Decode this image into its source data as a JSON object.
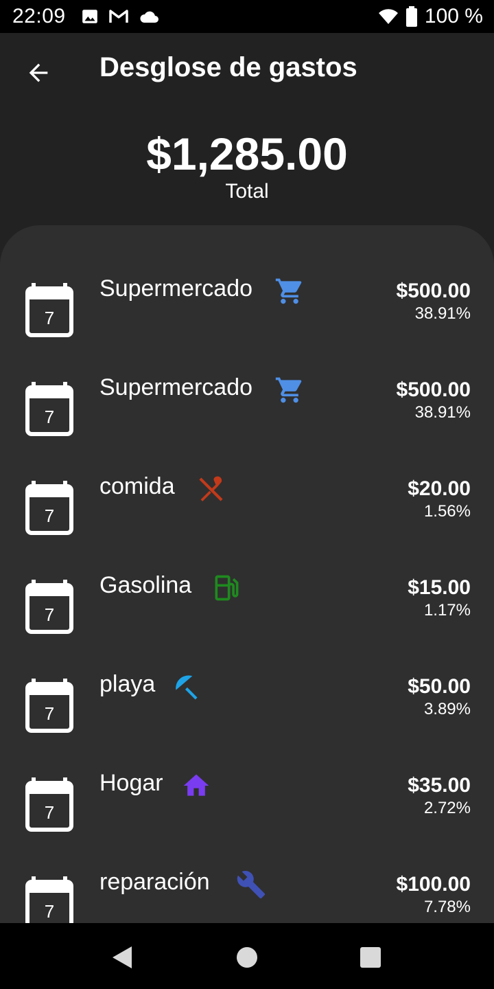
{
  "status_bar": {
    "time": "22:09",
    "battery_text": "100 %",
    "icons": [
      "image-icon",
      "gmail-icon",
      "cloud-icon",
      "wifi-icon",
      "battery-icon"
    ]
  },
  "app_bar": {
    "title": "Desglose de gastos",
    "back_icon": "arrow-back-icon"
  },
  "summary": {
    "total": "$1,285.00",
    "label": "Total"
  },
  "expenses": [
    {
      "name": "Supermercado",
      "date_day": "7",
      "amount": "$500.00",
      "percent": "38.91%",
      "icon": "shopping-cart-icon",
      "icon_color": "#4f8fe6"
    },
    {
      "name": "Supermercado",
      "date_day": "7",
      "amount": "$500.00",
      "percent": "38.91%",
      "icon": "shopping-cart-icon",
      "icon_color": "#4f8fe6"
    },
    {
      "name": "comida",
      "date_day": "7",
      "amount": "$20.00",
      "percent": "1.56%",
      "icon": "restaurant-icon",
      "icon_color": "#c23a1a"
    },
    {
      "name": "Gasolina",
      "date_day": "7",
      "amount": "$15.00",
      "percent": "1.17%",
      "icon": "gas-station-icon",
      "icon_color": "#1f8a1f"
    },
    {
      "name": "playa",
      "date_day": "7",
      "amount": "$50.00",
      "percent": "3.89%",
      "icon": "beach-umbrella-icon",
      "icon_color": "#1ea3e6"
    },
    {
      "name": "Hogar",
      "date_day": "7",
      "amount": "$35.00",
      "percent": "2.72%",
      "icon": "home-icon",
      "icon_color": "#7a3cf0"
    },
    {
      "name": "reparación",
      "date_day": "7",
      "amount": "$100.00",
      "percent": "7.78%",
      "icon": "wrench-icon",
      "icon_color": "#3f51b5"
    }
  ],
  "colors": {
    "background": "#222222",
    "panel": "#2f2f2f",
    "system_bars": "#000000"
  }
}
